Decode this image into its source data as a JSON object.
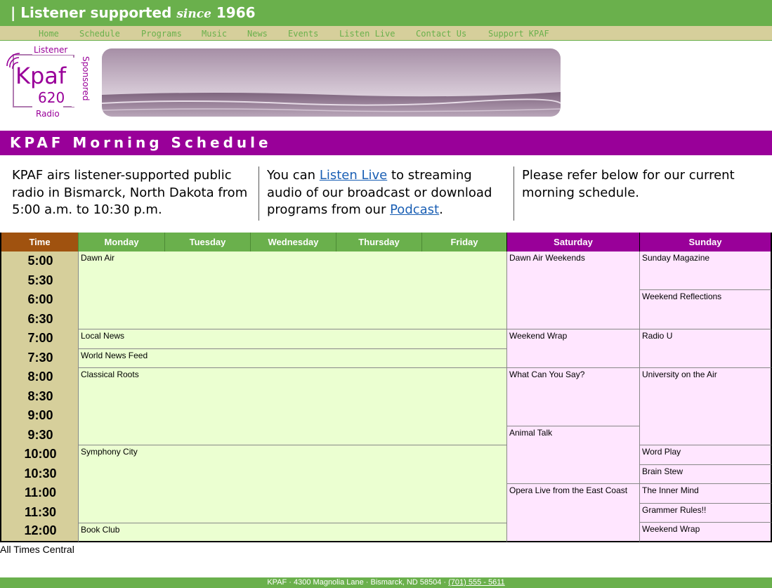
{
  "header": {
    "bar": "|",
    "tagline_a": "Listener supported",
    "tagline_since": "since",
    "tagline_year": "1966"
  },
  "nav": [
    "Home",
    "Schedule",
    "Programs",
    "Music",
    "News",
    "Events",
    "Listen Live",
    "Contact Us",
    "Support KPAF"
  ],
  "logo": {
    "top": "Listener",
    "name": "Kpaf",
    "freq": "620",
    "bottom": "Radio",
    "side": "Sponsored"
  },
  "page_title": "KPAF Morning Schedule",
  "intro": {
    "col1": "KPAF airs listener-supported public radio in Bismarck, North Dakota from 5:00 a.m. to 10:30 p.m.",
    "col2_pre": "You can ",
    "col2_link1": "Listen Live",
    "col2_mid": " to streaming audio of our broadcast or download programs from our ",
    "col2_link2": "Podcast",
    "col2_post": ".",
    "col3": "Please refer below for our current morning schedule."
  },
  "schedule": {
    "headers": {
      "time": "Time",
      "monday": "Monday",
      "tuesday": "Tuesday",
      "wednesday": "Wednesday",
      "thursday": "Thursday",
      "friday": "Friday",
      "saturday": "Saturday",
      "sunday": "Sunday"
    },
    "times": [
      "5:00",
      "5:30",
      "6:00",
      "6:30",
      "7:00",
      "7:30",
      "8:00",
      "8:30",
      "9:00",
      "9:30",
      "10:00",
      "10:30",
      "11:00",
      "11:30",
      "12:00"
    ],
    "weekday": [
      "Dawn Air",
      "Local News",
      "World News Feed",
      "Classical Roots",
      "Symphony City",
      "Book Club"
    ],
    "saturday": [
      "Dawn Air Weekends",
      "Weekend Wrap",
      "What Can You Say?",
      "Animal Talk",
      "Opera Live from the East Coast"
    ],
    "sunday": [
      "Sunday Magazine",
      "Weekend Reflections",
      "Radio U",
      "University on the Air",
      "Word Play",
      "Brain Stew",
      "The Inner Mind",
      "Grammer Rules!!",
      "Weekend Wrap"
    ]
  },
  "footnote": "All Times Central",
  "footer": {
    "address": "KPAF · 4300 Magnolia Lane · Bismarck, ND 58504 · ",
    "phone": "(701) 555 - 5611"
  },
  "colors": {
    "green": "#6ab04c",
    "tan": "#d6cf9b",
    "purple": "#990099",
    "time_header": "#a0520f",
    "weekday_cell": "#ebffd1",
    "weekend_cell": "#ffe6ff"
  }
}
